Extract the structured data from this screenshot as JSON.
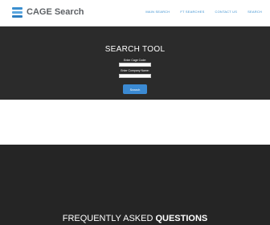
{
  "header": {
    "logo_text": "CAGE Search",
    "nav": [
      "MAIN SEARCH",
      "FT SEARCHES",
      "CONTACT US",
      "SEARCH"
    ]
  },
  "search": {
    "title": "SEARCH TOOL",
    "cage_label": "Enter Cage Code:",
    "company_label": "Enter Company Name:",
    "cage_value": "",
    "company_value": "",
    "button_label": "Search"
  },
  "faq": {
    "heading_light": "FREQUENTLY ASKED ",
    "heading_bold": "QUESTIONS"
  },
  "colors": {
    "accent": "#3b8ad3",
    "dark_band": "#2b2b2b"
  }
}
